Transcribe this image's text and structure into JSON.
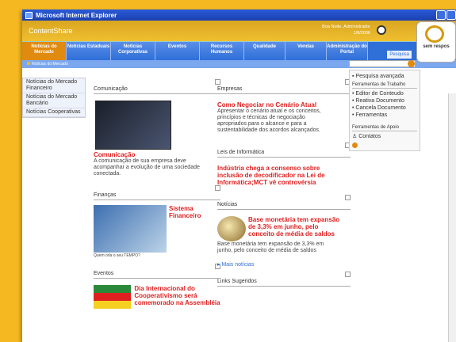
{
  "window": {
    "title": "Microsoft Internet Explorer"
  },
  "app": {
    "name": "ContentShare",
    "greeting": "Boa Noite, Administrador",
    "date": "1/8/2006"
  },
  "nav": {
    "tabs": [
      {
        "label": "Notícias do Mercado",
        "active": true
      },
      {
        "label": "Notícias Estaduais"
      },
      {
        "label": "Notícias Corporativas"
      },
      {
        "label": "Eventos"
      },
      {
        "label": "Recursos Humanos"
      },
      {
        "label": "Qualidade"
      },
      {
        "label": "Vendas"
      },
      {
        "label": "Administração do Portal"
      }
    ],
    "search_label": "Pesquisa",
    "sem_label": "sem respos"
  },
  "breadcrumb": "Notícias do Mercado",
  "sidebar": {
    "items": [
      "Notícias do Mercado Financeiro",
      "Notícias do Mercado Bancário",
      "Notícias Cooperativas"
    ]
  },
  "col1": {
    "sec1": "Comunicação",
    "sec1_headline": "Comunicação",
    "sec1_text": "A comunicação de sua empresa deve acompanhar a evolução de uma sociedade conectada.",
    "sec2": "Finanças",
    "sec2_headline": "Sistema Financeiro",
    "sec2_caption": "Quem orla o seu TEMPO?",
    "sec3": "Eventos",
    "sec3_headline": "Dia Internacional do Cooperativismo será comemorado na Assembléia"
  },
  "col2": {
    "sec1": "Empresas",
    "sec1_headline": "Como Negociar no Cenário Atual",
    "sec1_text": "Apresentar o cenário atual e os conceitos, princípios e técnicas de negociação apropriados para o alcance e para a sustentabilidade dos acordos alcançados.",
    "sec2": "Leis de Informática",
    "sec2_headline": "Indústria chega a consenso sobre inclusão de decodificador na Lei de Informática;MCT vê controvérsia",
    "sec3": "Notícias",
    "sec3_headline": "Base monetária tem expansão de 3,3% em junho, pelo conceito de média de saldos",
    "sec3_text": "Base monetária tem expansão de 3,3% em junho, pelo conceito de média de saldos",
    "more": "Mais notícias",
    "sec4": "Links Sugeridos"
  },
  "right": {
    "search_adv": "Pesquisa avançada",
    "tools_head": "Ferramentas de Trabalho",
    "tools": [
      "Editor de Conteudo",
      "Reativa Documento",
      "Cancela Documento",
      "Ferramentas"
    ],
    "support_head": "Ferramentas de Apoio",
    "contacts": "Contatos"
  }
}
